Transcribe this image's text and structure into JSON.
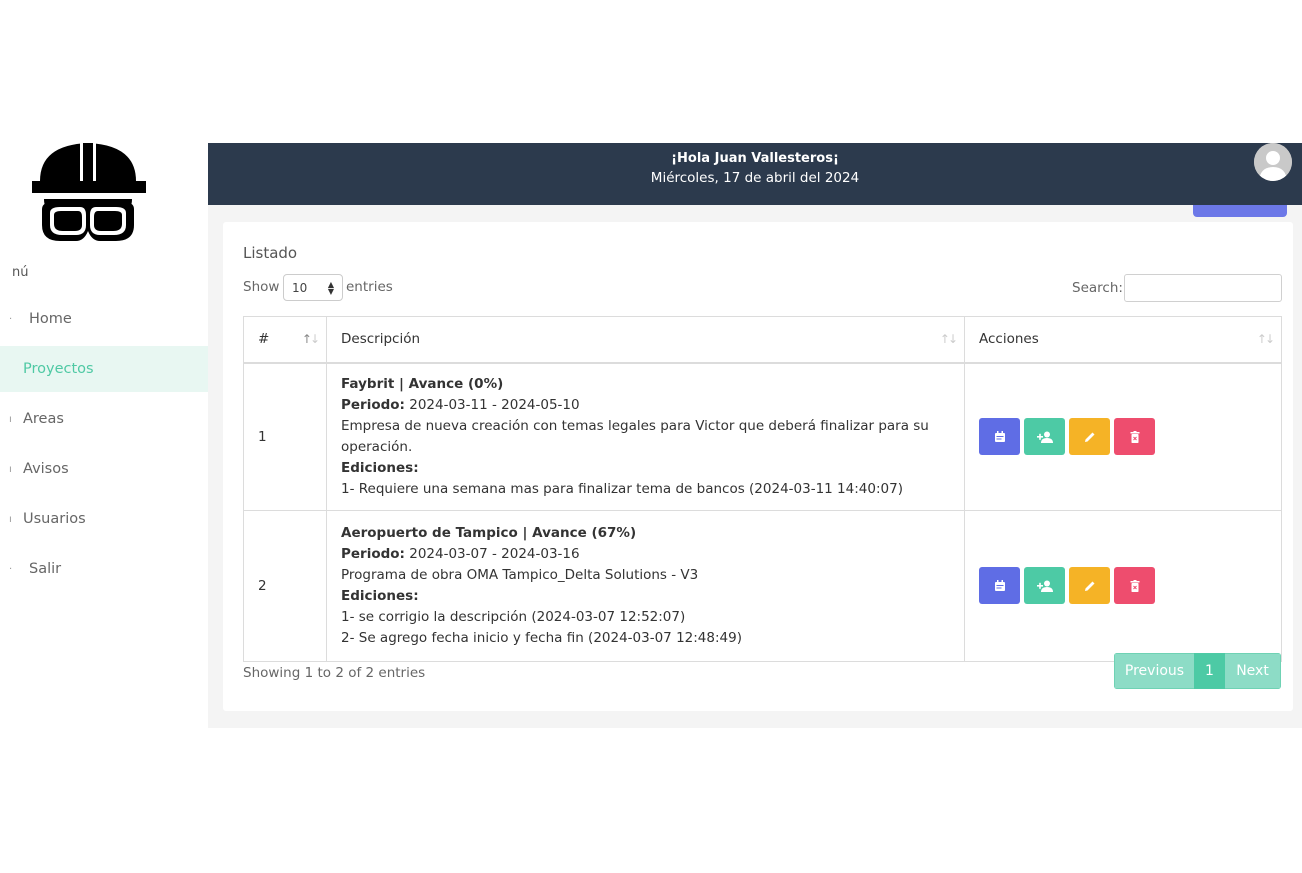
{
  "sidebar": {
    "menu_heading": "nú",
    "items": [
      {
        "label": "Home"
      },
      {
        "label": "Proyectos"
      },
      {
        "label": "Areas"
      },
      {
        "label": "Avisos"
      },
      {
        "label": "Usuarios"
      },
      {
        "label": "Salir"
      }
    ]
  },
  "header": {
    "greeting": "¡Hola Juan Vallesteros¡",
    "date": "Miércoles, 17 de abril del 2024"
  },
  "card": {
    "title": "Listado",
    "show_label": "Show",
    "page_length": "10",
    "entries_label": "entries",
    "search_label": "Search:",
    "search_value": ""
  },
  "table": {
    "columns": [
      "#",
      "Descripción",
      "Acciones"
    ],
    "rows": [
      {
        "num": "1",
        "title": "Faybrit | Avance (0%)",
        "period_label": "Periodo:",
        "period": " 2024-03-11 - 2024-05-10",
        "description": "Empresa de nueva creación con temas legales para Victor que deberá finalizar para su operación.",
        "editions_label": "Ediciones:",
        "editions": [
          "1- Requiere una semana mas para finalizar tema de bancos (2024-03-11 14:40:07)"
        ]
      },
      {
        "num": "2",
        "title": "Aeropuerto de Tampico | Avance (67%)",
        "period_label": "Periodo:",
        "period": " 2024-03-07 - 2024-03-16",
        "description": "Programa de obra OMA Tampico_Delta Solutions - V3",
        "editions_label": "Ediciones:",
        "editions": [
          "1- se corrigio la descripción (2024-03-07 12:52:07)",
          "2- Se agrego fecha inicio y fecha fin (2024-03-07 12:48:49)"
        ]
      }
    ]
  },
  "footer": {
    "info": "Showing 1 to 2 of 2 entries",
    "previous": "Previous",
    "page": "1",
    "next": "Next"
  },
  "colors": {
    "topbar": "#2c3a4d",
    "accent": "#4dcaa5",
    "calendar_btn": "#5f6de5",
    "edit_btn": "#f5b326",
    "delete_btn": "#ee4d6e"
  }
}
